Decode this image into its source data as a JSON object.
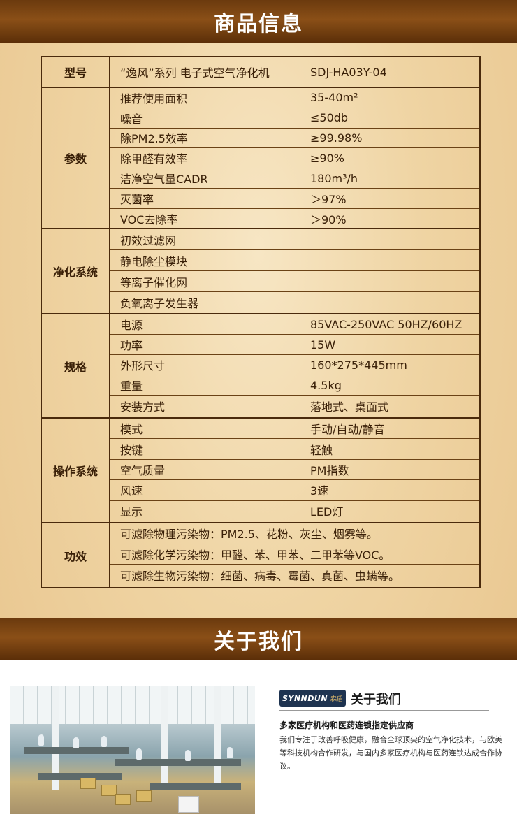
{
  "header": {
    "title": "商品信息"
  },
  "spec": {
    "model_label": "型号",
    "model_name": "“逸风”系列 电子式空气净化机",
    "model_code": "SDJ-HA03Y-04",
    "params": {
      "label": "参数",
      "rows": [
        {
          "k": "推荐使用面积",
          "v": "35-40m²"
        },
        {
          "k": "噪音",
          "v": "≤50db"
        },
        {
          "k": "除PM2.5效率",
          "v": "≥99.98%"
        },
        {
          "k": "除甲醛有效率",
          "v": "≥90%"
        },
        {
          "k": "洁净空气量CADR",
          "v": "180m³/h"
        },
        {
          "k": "灭菌率",
          "v": "＞97%"
        },
        {
          "k": "VOC去除率",
          "v": "＞90%"
        }
      ]
    },
    "purify": {
      "label": "净化系统",
      "rows": [
        "初效过滤网",
        "静电除尘模块",
        "等离子催化网",
        "负氧离子发生器"
      ]
    },
    "size": {
      "label": "规格",
      "rows": [
        {
          "k": "电源",
          "v": "85VAC-250VAC  50HZ/60HZ"
        },
        {
          "k": "功率",
          "v": "15W"
        },
        {
          "k": "外形尺寸",
          "v": "160*275*445mm"
        },
        {
          "k": "重量",
          "v": "4.5kg"
        },
        {
          "k": "安装方式",
          "v": "落地式、桌面式"
        }
      ]
    },
    "operate": {
      "label": "操作系统",
      "rows": [
        {
          "k": "模式",
          "v": "手动/自动/静音"
        },
        {
          "k": "按键",
          "v": "轻触"
        },
        {
          "k": "空气质量",
          "v": "PM指数"
        },
        {
          "k": "风速",
          "v": "3速"
        },
        {
          "k": "显示",
          "v": "LED灯"
        }
      ]
    },
    "effect": {
      "label": "功效",
      "rows": [
        "可滤除物理污染物：PM2.5、花粉、灰尘、烟雾等。",
        "可滤除化学污染物：甲醛、苯、甲苯、二甲苯等VOC。",
        "可滤除生物污染物：细菌、病毒、霉菌、真菌、虫螨等。"
      ]
    }
  },
  "about": {
    "banner_title": "关于我们",
    "logo_brand": "SYNNDUN",
    "logo_cn": "森盾",
    "title": "关于我们",
    "headline": "多家医疗机构和医药连锁指定供应商",
    "body": "我们专注于改善呼吸健康，融合全球顶尖的空气净化技术，与欧美等科技机构合作研发，与国内多家医疗机构与医药连锁达成合作协议。"
  }
}
